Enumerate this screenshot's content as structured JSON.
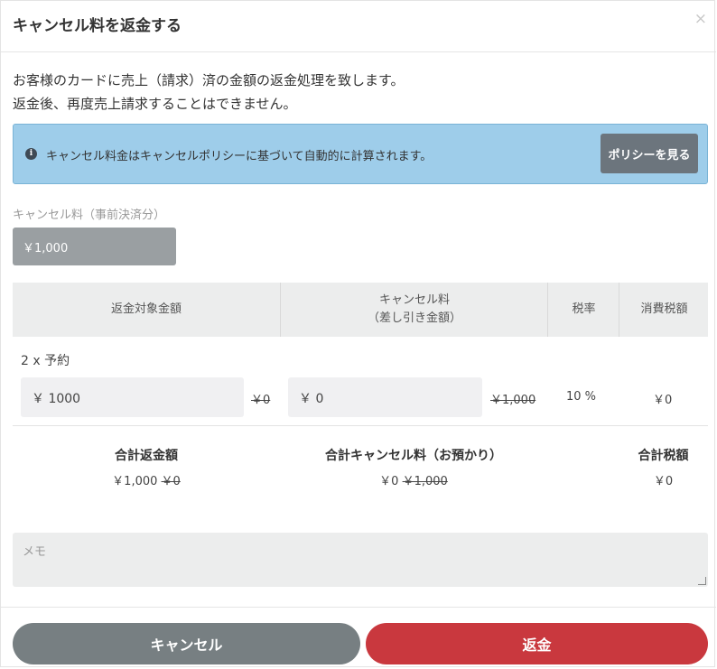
{
  "dialog": {
    "title": "キャンセル料を返金する",
    "close": "×"
  },
  "description": {
    "line1": "お客様のカードに売上（請求）済の金額の返金処理を致します。",
    "line2": "返金後、再度売上請求することはできません。"
  },
  "info": {
    "icon": "info-icon",
    "text": "キャンセル料金はキャンセルポリシーに基づいて自動的に計算されます。",
    "button": "ポリシーを見る"
  },
  "prepaid_fee": {
    "label": "キャンセル料（事前決済分）",
    "value": "￥1,000"
  },
  "table": {
    "headers": {
      "refund_target": "返金対象金額",
      "cancel_fee_line1": "キャンセル料",
      "cancel_fee_line2": "（差し引き金額）",
      "tax_rate": "税率",
      "tax": "消費税額"
    },
    "row": {
      "label": "2 x 予約",
      "refund_input": "￥ 1000",
      "refund_original": "￥0",
      "fee_input": "￥ 0",
      "fee_original": "￥1,000",
      "tax_rate": "10 %",
      "tax": "￥0"
    }
  },
  "totals": {
    "refund_label": "合計返金額",
    "refund_value": "￥1,000",
    "refund_original": "￥0",
    "fee_label": "合計キャンセル料（お預かり）",
    "fee_value": "￥0",
    "fee_original": "￥1,000",
    "tax_label": "合計税額",
    "tax_value": "￥0"
  },
  "memo": {
    "placeholder": "メモ"
  },
  "footer": {
    "cancel": "キャンセル",
    "refund": "返金"
  },
  "colors": {
    "info_bg": "#9ecdea",
    "secondary": "#6c757d",
    "danger": "#c9383e"
  }
}
